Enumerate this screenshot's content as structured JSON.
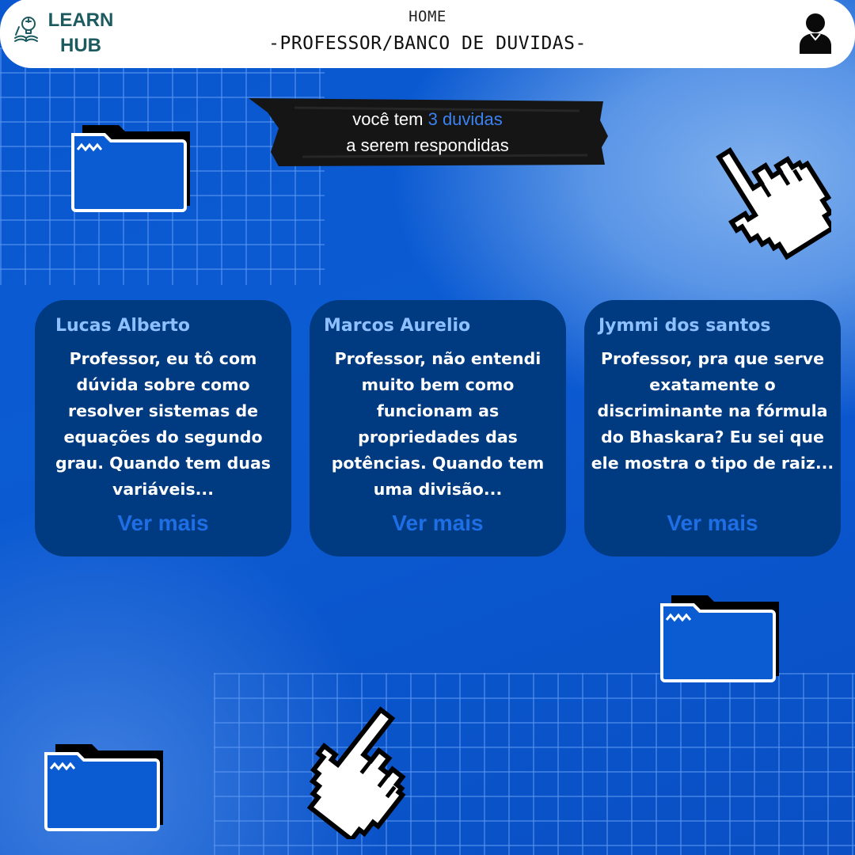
{
  "header": {
    "logo_line1": "LEARN",
    "logo_line2": "HUB",
    "nav_home": "HOME",
    "page_title": "-PROFESSOR/BANCO DE DUVIDAS-"
  },
  "banner": {
    "prefix": "você tem ",
    "highlight": "3 duvidas",
    "line2": "a serem respondidas"
  },
  "questions": [
    {
      "author": "Lucas Alberto",
      "text": "Professor, eu tô com dúvida sobre como resolver sistemas de equações do segundo grau. Quando tem duas variáveis...",
      "more": "Ver mais"
    },
    {
      "author": "Marcos Aurelio",
      "text": "Professor, não entendi muito bem como funcionam as propriedades das potências. Quando tem uma divisão...",
      "more": "Ver mais"
    },
    {
      "author": "Jymmi dos santos",
      "text": "Professor, pra que serve exatamente o discriminante na fórmula do Bhaskara? Eu sei que ele mostra o tipo de raiz...",
      "more": "Ver mais"
    }
  ],
  "icons": {
    "logo": "lightbulb-book-icon",
    "profile": "user-icon",
    "folder": "folder-icon",
    "cursor": "pointer-hand-icon"
  },
  "colors": {
    "background": "#0b5bd3",
    "card": "#003a80",
    "author": "#8ec0ff",
    "link": "#1e6fe6",
    "logo": "#1b5a5e"
  }
}
